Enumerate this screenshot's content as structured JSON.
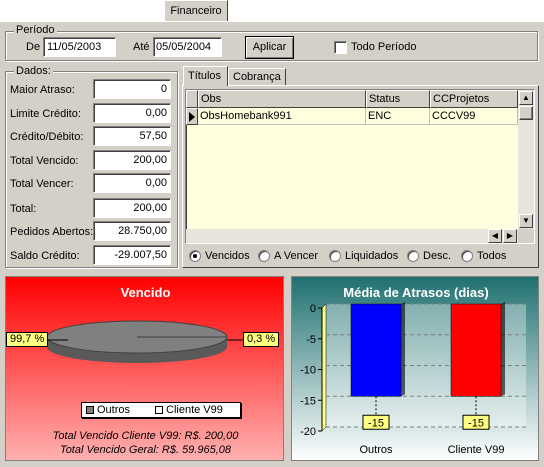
{
  "window": {
    "tab_label": "Financeiro"
  },
  "periodo": {
    "legend": "Período",
    "de_label": "De",
    "de_value": "11/05/2003",
    "ate_label": "Até",
    "ate_value": "05/05/2004",
    "apply_label": "Aplicar",
    "all_period_label": "Todo Período",
    "all_period_checked": false
  },
  "dados": {
    "legend": "Dados:",
    "rows": [
      {
        "label": "Maior Atraso:",
        "value": "0"
      },
      {
        "label": "Limite Crédito:",
        "value": "0,00"
      },
      {
        "label": "Crédito/Débito:",
        "value": "57,50"
      },
      {
        "label": "Total Vencido:",
        "value": "200,00"
      },
      {
        "label": "Total Vencer:",
        "value": "0,00"
      },
      {
        "label": "Total:",
        "value": "200,00"
      },
      {
        "label": "Pedidos Abertos:",
        "value": "28.750,00"
      },
      {
        "label": "Saldo Crédito:",
        "value": "-29.007,50"
      }
    ]
  },
  "titulos": {
    "tabs": [
      "Títulos",
      "Cobrança"
    ],
    "columns": [
      "Obs",
      "Status",
      "CCProjetos"
    ],
    "rows": [
      {
        "obs": "ObsHomebank991",
        "status": "ENC",
        "ccprojetos": "CCCV99"
      }
    ],
    "filters": [
      "Vencidos",
      "A Vencer",
      "Liquidados",
      "Desc.",
      "Todos"
    ],
    "selected_filter": 0
  },
  "pie_chart": {
    "title": "Vencido",
    "left_label": "99,7 %",
    "right_label": "0,3 %",
    "legend": [
      "Outros",
      "Cliente V99"
    ],
    "footer_line1": "Total Vencido Cliente V99: R$. 200,00",
    "footer_line2": "Total Vencido Geral: R$. 59.965,08",
    "background": "#ff0000",
    "slice_color": "#808080"
  },
  "chart_data": {
    "type": "bar",
    "title": "Média de Atrasos (dias)",
    "categories": [
      "Outros",
      "Cliente V99"
    ],
    "values": [
      -15,
      -15
    ],
    "colors": [
      "#0000ff",
      "#ff0000"
    ],
    "ylim": [
      -20,
      0
    ],
    "yticks": [
      "0",
      "-5",
      "-10",
      "-15",
      "-20"
    ],
    "value_labels": [
      "-15",
      "-15"
    ],
    "grid": true
  }
}
